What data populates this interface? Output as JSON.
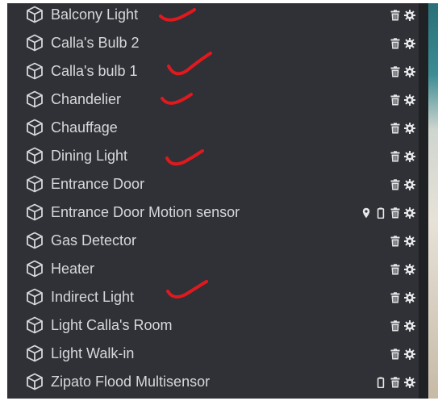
{
  "devices": [
    {
      "label": "Balcony Light",
      "icons": [
        "trash-icon",
        "gear-icon"
      ],
      "checked": true
    },
    {
      "label": "Calla's Bulb 2",
      "icons": [
        "trash-icon",
        "gear-icon"
      ],
      "checked": false
    },
    {
      "label": "Calla's bulb 1",
      "icons": [
        "trash-icon",
        "gear-icon"
      ],
      "checked": true
    },
    {
      "label": "Chandelier",
      "icons": [
        "trash-icon",
        "gear-icon"
      ],
      "checked": true
    },
    {
      "label": "Chauffage",
      "icons": [
        "trash-icon",
        "gear-icon"
      ],
      "checked": false
    },
    {
      "label": "Dining Light",
      "icons": [
        "trash-icon",
        "gear-icon"
      ],
      "checked": true
    },
    {
      "label": "Entrance Door",
      "icons": [
        "trash-icon",
        "gear-icon"
      ],
      "checked": false
    },
    {
      "label": "Entrance Door Motion sensor",
      "icons": [
        "pin-icon",
        "battery-icon",
        "trash-icon",
        "gear-icon"
      ],
      "checked": false
    },
    {
      "label": "Gas Detector",
      "icons": [
        "trash-icon",
        "gear-icon"
      ],
      "checked": false
    },
    {
      "label": "Heater",
      "icons": [
        "trash-icon",
        "gear-icon"
      ],
      "checked": false
    },
    {
      "label": "Indirect Light",
      "icons": [
        "trash-icon",
        "gear-icon"
      ],
      "checked": true
    },
    {
      "label": "Light Calla's Room",
      "icons": [
        "trash-icon",
        "gear-icon"
      ],
      "checked": false
    },
    {
      "label": "Light Walk-in",
      "icons": [
        "trash-icon",
        "gear-icon"
      ],
      "checked": false
    },
    {
      "label": "Zipato Flood Multisensor",
      "icons": [
        "battery-icon",
        "trash-icon",
        "gear-icon"
      ],
      "checked": false
    }
  ],
  "colors": {
    "panel": "#2f3136",
    "text": "#d6d8db",
    "icon": "#e6e7e9",
    "annotation": "#e0191e"
  }
}
